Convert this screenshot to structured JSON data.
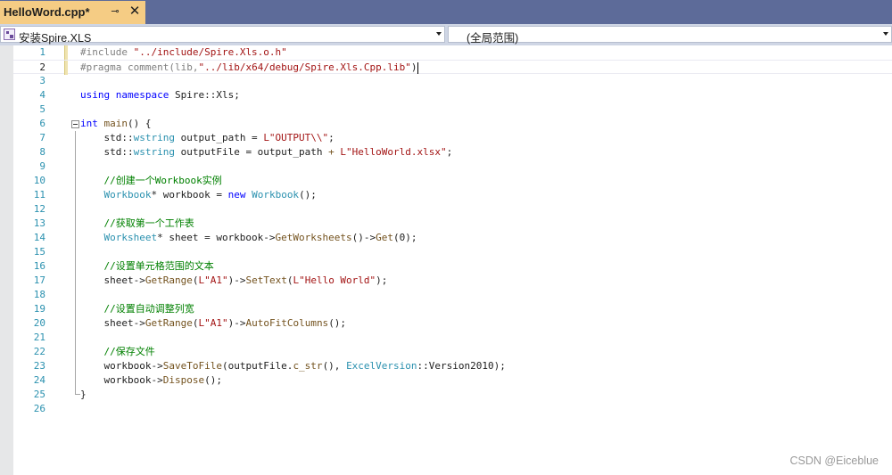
{
  "tab": {
    "title": "HelloWord.cpp*",
    "pin_glyph": "⊸",
    "close_glyph": "✕"
  },
  "navbar": {
    "left_dropdown": "安装Spire.XLS",
    "right_dropdown": "(全局范围)"
  },
  "code_lines": [
    {
      "n": "1",
      "segments": [
        {
          "c": "pp",
          "t": "#include "
        },
        {
          "c": "str",
          "t": "\"../include/Spire.Xls.o.h\""
        }
      ]
    },
    {
      "n": "2",
      "segments": [
        {
          "c": "pp",
          "t": "#pragma "
        },
        {
          "c": "pp",
          "t": "comment(lib,"
        },
        {
          "c": "str",
          "t": "\"../lib/x64/debug/Spire.Xls.Cpp.lib\""
        },
        {
          "c": "",
          "t": ")"
        }
      ]
    },
    {
      "n": "3",
      "segments": []
    },
    {
      "n": "4",
      "segments": [
        {
          "c": "kw",
          "t": "using namespace "
        },
        {
          "c": "",
          "t": "Spire::Xls;"
        }
      ]
    },
    {
      "n": "5",
      "segments": []
    },
    {
      "n": "6",
      "segments": [
        {
          "c": "kw",
          "t": "int "
        },
        {
          "c": "fn",
          "t": "main"
        },
        {
          "c": "",
          "t": "() {"
        }
      ]
    },
    {
      "n": "7",
      "segments": [
        {
          "c": "",
          "t": "    std::"
        },
        {
          "c": "ty",
          "t": "wstring"
        },
        {
          "c": "",
          "t": " output_path = "
        },
        {
          "c": "str",
          "t": "L\"OUTPUT\\\\\""
        },
        {
          "c": "",
          "t": ";"
        }
      ]
    },
    {
      "n": "8",
      "segments": [
        {
          "c": "",
          "t": "    std::"
        },
        {
          "c": "ty",
          "t": "wstring"
        },
        {
          "c": "",
          "t": " outputFile = output_path "
        },
        {
          "c": "fn",
          "t": "+"
        },
        {
          "c": "",
          "t": " "
        },
        {
          "c": "str",
          "t": "L\"HelloWorld.xlsx\""
        },
        {
          "c": "",
          "t": ";"
        }
      ]
    },
    {
      "n": "9",
      "segments": []
    },
    {
      "n": "10",
      "segments": [
        {
          "c": "cm",
          "t": "    //创建一个Workbook实例"
        }
      ]
    },
    {
      "n": "11",
      "segments": [
        {
          "c": "ty",
          "t": "    Workbook"
        },
        {
          "c": "",
          "t": "* workbook = "
        },
        {
          "c": "kw",
          "t": "new "
        },
        {
          "c": "ty",
          "t": "Workbook"
        },
        {
          "c": "",
          "t": "();"
        }
      ]
    },
    {
      "n": "12",
      "segments": []
    },
    {
      "n": "13",
      "segments": [
        {
          "c": "cm",
          "t": "    //获取第一个工作表"
        }
      ]
    },
    {
      "n": "14",
      "segments": [
        {
          "c": "ty",
          "t": "    Worksheet"
        },
        {
          "c": "",
          "t": "* sheet = workbook->"
        },
        {
          "c": "fn",
          "t": "GetWorksheets"
        },
        {
          "c": "",
          "t": "()->"
        },
        {
          "c": "fn",
          "t": "Get"
        },
        {
          "c": "",
          "t": "(0);"
        }
      ]
    },
    {
      "n": "15",
      "segments": []
    },
    {
      "n": "16",
      "segments": [
        {
          "c": "cm",
          "t": "    //设置单元格范围的文本"
        }
      ]
    },
    {
      "n": "17",
      "segments": [
        {
          "c": "",
          "t": "    sheet->"
        },
        {
          "c": "fn",
          "t": "GetRange"
        },
        {
          "c": "",
          "t": "("
        },
        {
          "c": "str",
          "t": "L\"A1\""
        },
        {
          "c": "",
          "t": ")->"
        },
        {
          "c": "fn",
          "t": "SetText"
        },
        {
          "c": "",
          "t": "("
        },
        {
          "c": "str",
          "t": "L\"Hello World\""
        },
        {
          "c": "",
          "t": ");"
        }
      ]
    },
    {
      "n": "18",
      "segments": []
    },
    {
      "n": "19",
      "segments": [
        {
          "c": "cm",
          "t": "    //设置自动调整列宽"
        }
      ]
    },
    {
      "n": "20",
      "segments": [
        {
          "c": "",
          "t": "    sheet->"
        },
        {
          "c": "fn",
          "t": "GetRange"
        },
        {
          "c": "",
          "t": "("
        },
        {
          "c": "str",
          "t": "L\"A1\""
        },
        {
          "c": "",
          "t": ")->"
        },
        {
          "c": "fn",
          "t": "AutoFitColumns"
        },
        {
          "c": "",
          "t": "();"
        }
      ]
    },
    {
      "n": "21",
      "segments": []
    },
    {
      "n": "22",
      "segments": [
        {
          "c": "cm",
          "t": "    //保存文件"
        }
      ]
    },
    {
      "n": "23",
      "segments": [
        {
          "c": "",
          "t": "    workbook->"
        },
        {
          "c": "fn",
          "t": "SaveToFile"
        },
        {
          "c": "",
          "t": "(outputFile."
        },
        {
          "c": "fn",
          "t": "c_str"
        },
        {
          "c": "",
          "t": "(), "
        },
        {
          "c": "ty",
          "t": "ExcelVersion"
        },
        {
          "c": "",
          "t": "::Version2010);"
        }
      ]
    },
    {
      "n": "24",
      "segments": [
        {
          "c": "",
          "t": "    workbook->"
        },
        {
          "c": "fn",
          "t": "Dispose"
        },
        {
          "c": "",
          "t": "();"
        }
      ]
    },
    {
      "n": "25",
      "segments": [
        {
          "c": "",
          "t": "}"
        }
      ]
    },
    {
      "n": "26",
      "segments": []
    }
  ],
  "current_line": "2",
  "watermark": "CSDN @Eiceblue"
}
